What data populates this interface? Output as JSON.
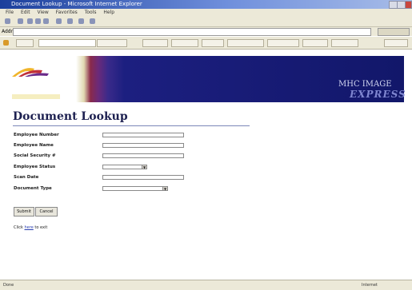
{
  "window": {
    "title": "Document Lookup - Microsoft Internet Explorer"
  },
  "menu": [
    "File",
    "Edit",
    "View",
    "Favorites",
    "Tools",
    "Help"
  ],
  "address": {
    "label": "Address",
    "url": ""
  },
  "banner": {
    "brand_line1": "MHC IMAGE",
    "brand_line2": "EXPRESS",
    "logo_line1": "",
    "logo_line2": ""
  },
  "page": {
    "title": "Document Lookup"
  },
  "form": {
    "fields": [
      {
        "label": "Employee Number",
        "type": "text"
      },
      {
        "label": "Employee Name",
        "type": "text"
      },
      {
        "label": "Social Security #",
        "type": "text"
      },
      {
        "label": "Employee Status",
        "type": "select"
      },
      {
        "label": "Scan Date",
        "type": "text"
      },
      {
        "label": "Document Type",
        "type": "select"
      }
    ],
    "submit_label": "Submit",
    "cancel_label": "Cancel"
  },
  "footer": {
    "prefix": "Click",
    "link": "here",
    "suffix": "to exit"
  },
  "status": {
    "left": "Done",
    "right": "Internet"
  }
}
